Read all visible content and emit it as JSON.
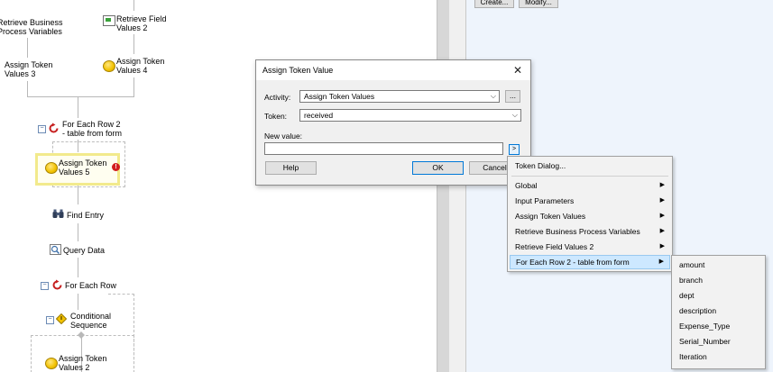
{
  "workflow": {
    "nodes": {
      "retrieve_bpv": "Retrieve Business\nProcess Variables",
      "retrieve_field": "Retrieve Field\nValues 2",
      "assign3": "Assign Token\nValues 3",
      "assign4": "Assign Token\nValues 4",
      "foreach2": "For Each Row 2\n- table from form",
      "assign5": "Assign Token\nValues 5",
      "find_entry": "Find Entry",
      "query_data": "Query Data",
      "foreach": "For Each Row",
      "conditional": "Conditional\nSequence",
      "assign2": "Assign Token\nValues 2"
    },
    "error_badge": "!"
  },
  "properties_panel": {
    "create_label": "Create...",
    "modify_label": "Modify..."
  },
  "dialog": {
    "title": "Assign Token Value",
    "close_glyph": "✕",
    "activity_label": "Activity:",
    "activity_value": "Assign Token Values",
    "browse_label": "...",
    "token_label": "Token:",
    "token_value": "received",
    "new_value_label": "New value:",
    "new_value": "",
    "token_button_label": ">",
    "help_label": "Help",
    "ok_label": "OK",
    "cancel_label": "Cancel"
  },
  "token_menu": {
    "items": [
      "Token Dialog...",
      "Global",
      "Input Parameters",
      "Assign Token Values",
      "Retrieve Business Process Variables",
      "Retrieve Field Values 2",
      "For Each Row 2 - table from form"
    ],
    "submenu_arrow": "▶"
  },
  "sub_menu": {
    "items": [
      "amount",
      "branch",
      "dept",
      "description",
      "Expense_Type",
      "Serial_Number",
      "Iteration"
    ]
  },
  "colors": {
    "accent": "#0078d7",
    "menu_highlight": "#cde8ff",
    "selection_yellow": "#f2ea8c",
    "panel_blue": "#eef4fc"
  }
}
